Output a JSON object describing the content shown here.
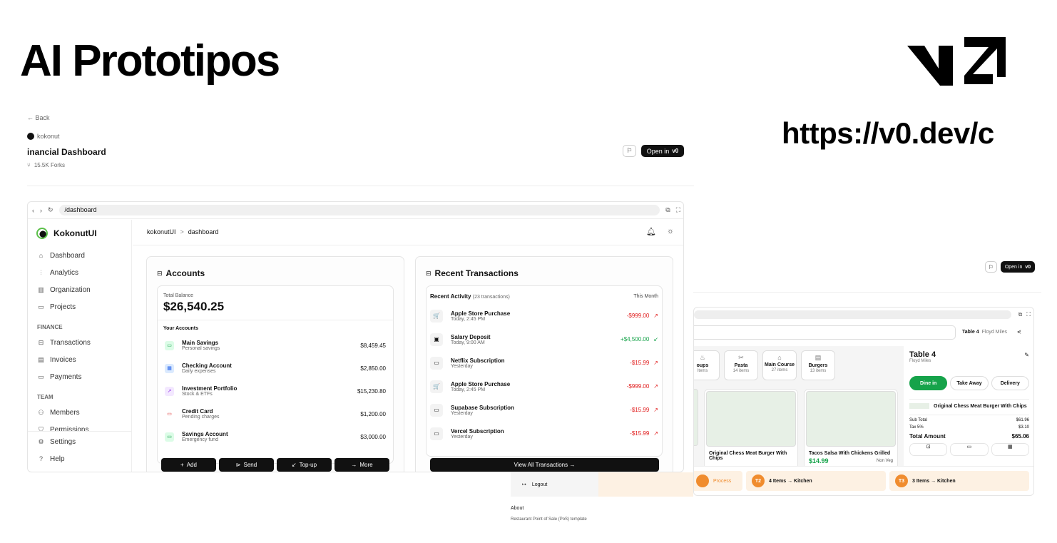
{
  "header": {
    "title": "AI Prototipos",
    "url": "https://v0.dev/c"
  },
  "project": {
    "back": "← Back",
    "author": "kokonut",
    "name": "inancial Dashboard",
    "forks": "15.5K Forks",
    "open_label": "Open in"
  },
  "browser": {
    "address": "/dashboard"
  },
  "app": {
    "brand": "KokonutUI",
    "breadcrumb_root": "kokonutUI",
    "breadcrumb_sep": ">",
    "breadcrumb_page": "dashboard",
    "nav": [
      {
        "label": "Dashboard",
        "icon": "home-icon"
      },
      {
        "label": "Analytics",
        "icon": "bar-chart-icon"
      },
      {
        "label": "Organization",
        "icon": "building-icon"
      },
      {
        "label": "Projects",
        "icon": "folder-icon"
      }
    ],
    "finance_header": "FINANCE",
    "finance_nav": [
      {
        "label": "Transactions",
        "icon": "wallet-icon"
      },
      {
        "label": "Invoices",
        "icon": "receipt-icon"
      },
      {
        "label": "Payments",
        "icon": "credit-card-icon"
      }
    ],
    "team_header": "TEAM",
    "team_nav": [
      {
        "label": "Members",
        "icon": "users-icon"
      },
      {
        "label": "Permissions",
        "icon": "shield-icon"
      }
    ],
    "bottom_nav": [
      {
        "label": "Settings",
        "icon": "gear-icon"
      },
      {
        "label": "Help",
        "icon": "help-icon"
      }
    ]
  },
  "accounts": {
    "title": "Accounts",
    "total_label": "Total Balance",
    "total_value": "$26,540.25",
    "your_accounts": "Your Accounts",
    "items": [
      {
        "name": "Main Savings",
        "sub": "Personal savings",
        "amount": "$8,459.45",
        "color": "#16a34a",
        "bg": "#dcfce7",
        "glyph": "▭"
      },
      {
        "name": "Checking Account",
        "sub": "Daily expenses",
        "amount": "$2,850.00",
        "color": "#2563eb",
        "bg": "#dbeafe",
        "glyph": "▦"
      },
      {
        "name": "Investment Portfolio",
        "sub": "Stock & ETFs",
        "amount": "$15,230.80",
        "color": "#9333ea",
        "bg": "#f3e8ff",
        "glyph": "↗"
      },
      {
        "name": "Credit Card",
        "sub": "Pending charges",
        "amount": "$1,200.00",
        "color": "#dc2626",
        "bg": "#ffffff",
        "glyph": "▭"
      },
      {
        "name": "Savings Account",
        "sub": "Emergency fund",
        "amount": "$3,000.00",
        "color": "#16a34a",
        "bg": "#dcfce7",
        "glyph": "▭"
      }
    ],
    "buttons": [
      {
        "label": "Add",
        "glyph": "+"
      },
      {
        "label": "Send",
        "glyph": "⊳"
      },
      {
        "label": "Top-up",
        "glyph": "↙"
      },
      {
        "label": "More",
        "glyph": "→"
      }
    ]
  },
  "transactions": {
    "title": "Recent Transactions",
    "activity_label": "Recent Activity",
    "activity_count": "(23 transactions)",
    "period": "This Month",
    "items": [
      {
        "name": "Apple Store Purchase",
        "time": "Today, 2:45 PM",
        "amount": "-$999.00",
        "dir": "↗",
        "kind": "neg",
        "glyph": "🛒"
      },
      {
        "name": "Salary Deposit",
        "time": "Today, 9:00 AM",
        "amount": "+$4,500.00",
        "dir": "↙",
        "kind": "pos",
        "glyph": "▣"
      },
      {
        "name": "Netflix Subscription",
        "time": "Yesterday",
        "amount": "-$15.99",
        "dir": "↗",
        "kind": "neg",
        "glyph": "▭"
      },
      {
        "name": "Apple Store Purchase",
        "time": "Today, 2:45 PM",
        "amount": "-$999.00",
        "dir": "↗",
        "kind": "neg",
        "glyph": "🛒"
      },
      {
        "name": "Supabase Subscription",
        "time": "Yesterday",
        "amount": "-$15.99",
        "dir": "↗",
        "kind": "neg",
        "glyph": "▭"
      },
      {
        "name": "Vercel Subscription",
        "time": "Yesterday",
        "amount": "-$15.99",
        "dir": "↗",
        "kind": "neg",
        "glyph": "▭"
      }
    ],
    "view_all": "View All Transactions →"
  },
  "pos": {
    "open_label": "Open in",
    "table_tag": "Table 4",
    "waiter": "Floyd Miles",
    "categories": [
      {
        "name": "oups",
        "count": "Items"
      },
      {
        "name": "Pasta",
        "count": "14 items"
      },
      {
        "name": "Main Course",
        "count": "27 items"
      },
      {
        "name": "Burgers",
        "count": "13 items"
      }
    ],
    "panel_title": "Table 4",
    "panel_sub": "Floyd Miles",
    "modes": [
      "Dine in",
      "Take Away",
      "Delivery"
    ],
    "order_item": "Original Chess Meat Burger With Chips",
    "sub_total_label": "Sub Total",
    "sub_total": "$61.96",
    "tax_label": "Tax 5%",
    "tax": "$3.10",
    "total_label": "Total Amount",
    "total": "$65.06",
    "item1_name": "Original Chess Meat Burger With Chips",
    "item2_name": "Tacos Salsa With Chickens Grilled",
    "item2_price": "$14.99",
    "item2_tag": "Non Veg",
    "kitchen": [
      {
        "badge": "",
        "label": "Process"
      },
      {
        "badge": "T2",
        "label": "4 Items → Kitchen"
      },
      {
        "badge": "T3",
        "label": "3 Items → Kitchen"
      }
    ],
    "logout": "Logout",
    "about_title": "About",
    "about_text": "Restaurant Point of Sale (PoS) template"
  }
}
